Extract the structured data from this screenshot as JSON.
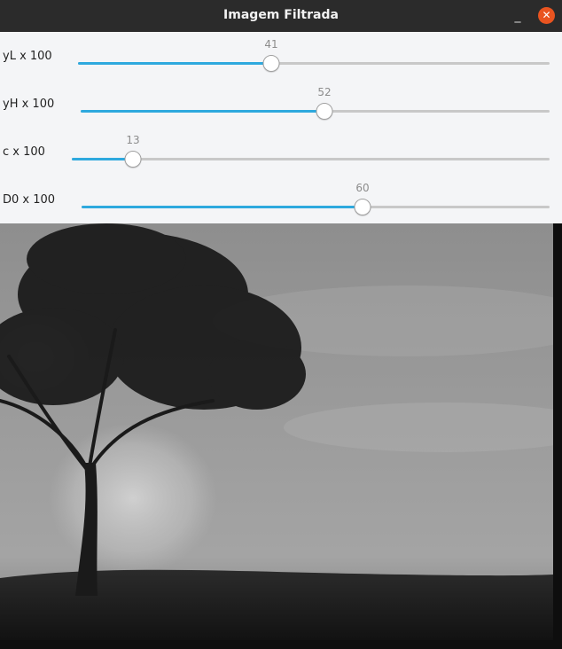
{
  "window": {
    "title": "Imagem Filtrada",
    "minimize_glyph": "_",
    "close_glyph": "✕"
  },
  "sliders": [
    {
      "label": "yL x 100",
      "value": "41",
      "fraction": 0.41
    },
    {
      "label": "yH x 100",
      "value": "52",
      "fraction": 0.52
    },
    {
      "label": "c x 100",
      "value": "13",
      "fraction": 0.13
    },
    {
      "label": "D0 x 100",
      "value": "60",
      "fraction": 0.6
    }
  ],
  "colors": {
    "accent": "#2ea9de",
    "close_button": "#e95420",
    "titlebar": "#2b2b2b",
    "panel": "#f4f5f7"
  }
}
